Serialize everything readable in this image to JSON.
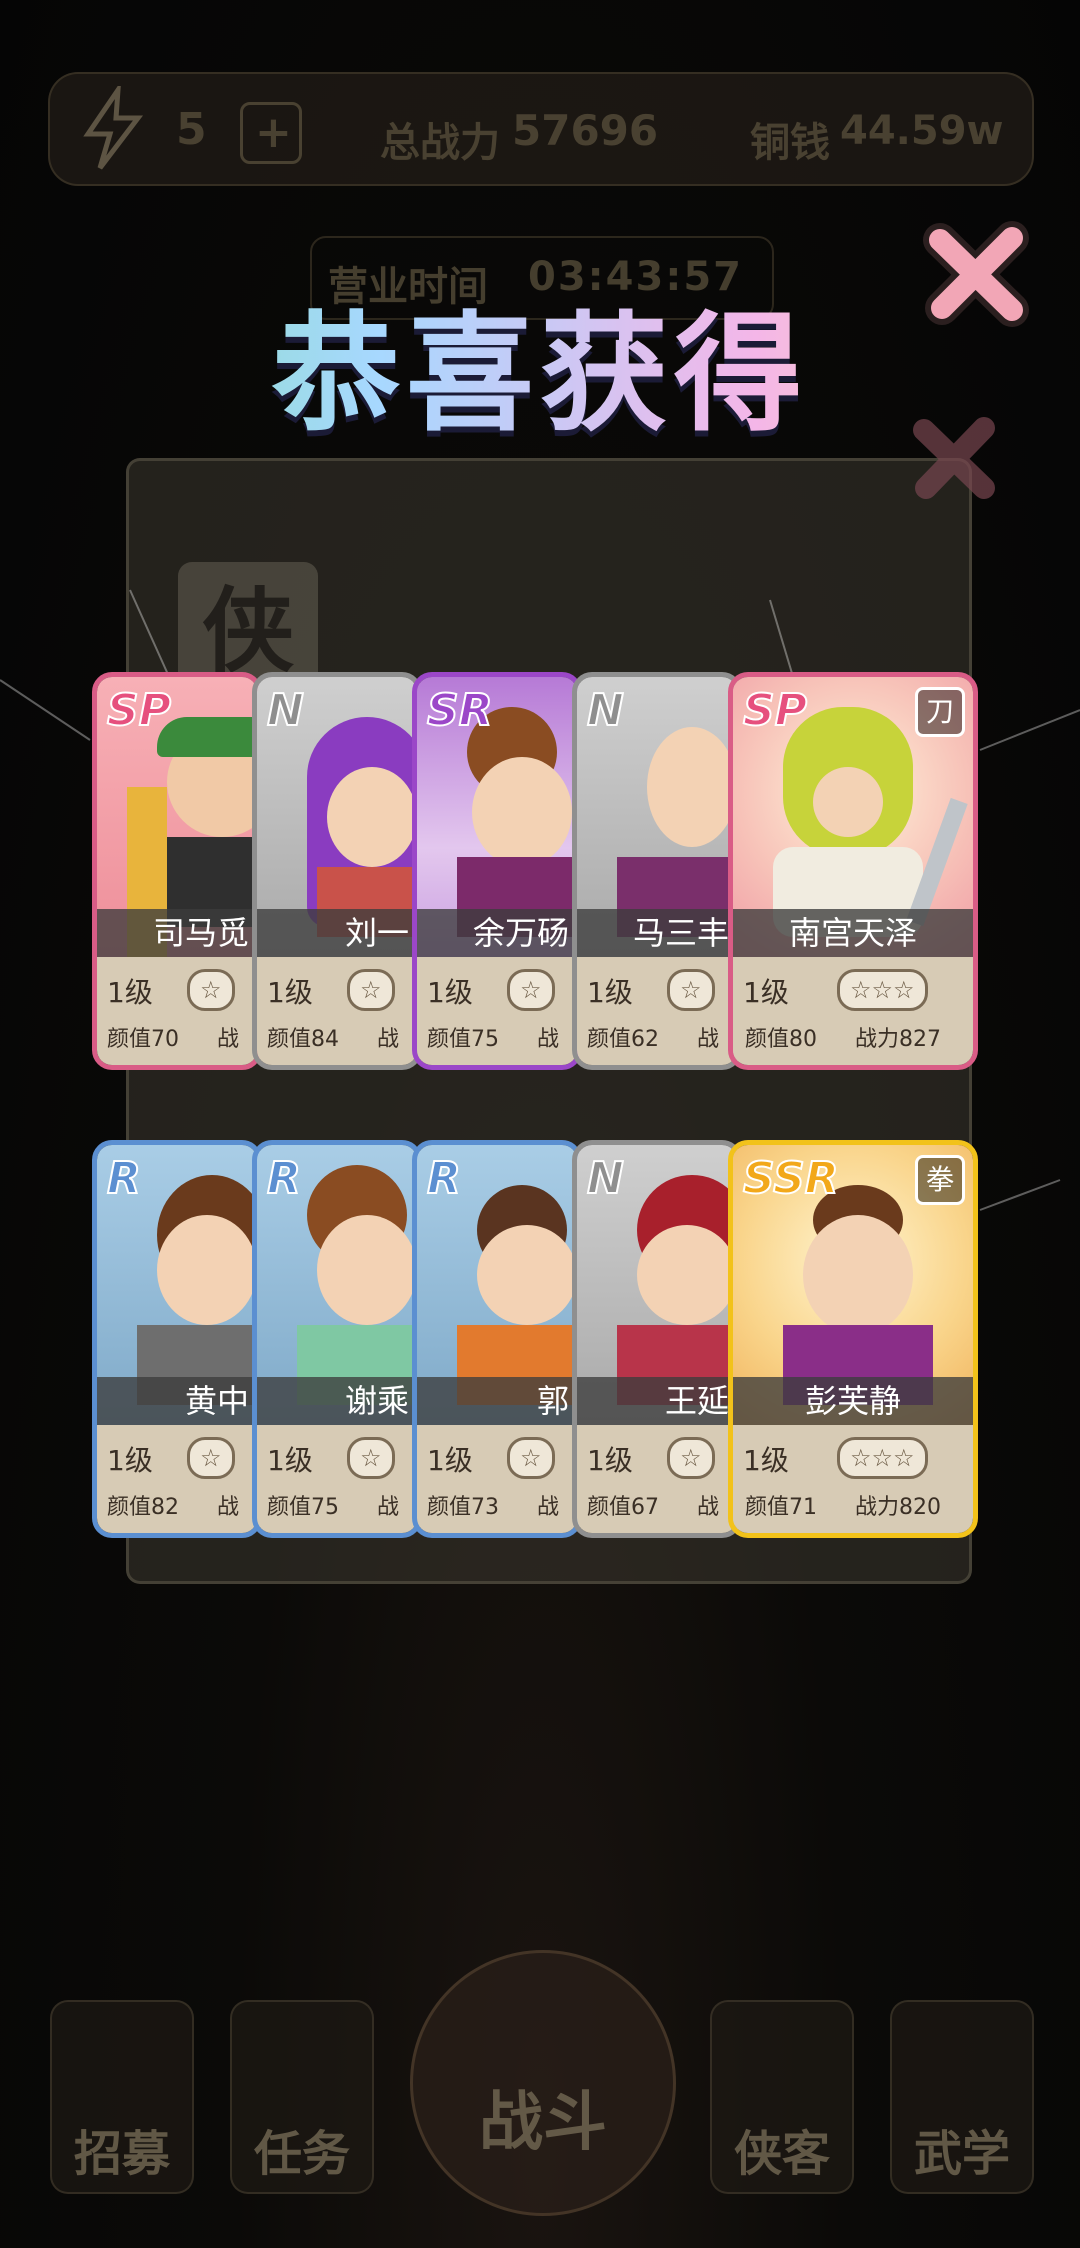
{
  "header": {
    "energy": "5",
    "power_label": "总战力",
    "power_value": "57696",
    "coin_label": "铜钱",
    "coin_value": "44.59w",
    "business_label": "营业时间",
    "business_time": "03:43:57"
  },
  "dim_panel": {
    "tag": "侠"
  },
  "popup": {
    "title": "恭喜获得"
  },
  "cards": [
    {
      "rarity": "SP",
      "name": "司马觅",
      "level": "1级",
      "stars": "☆",
      "charm": "颜值70",
      "power": "战"
    },
    {
      "rarity": "N",
      "name": "刘一",
      "level": "1级",
      "stars": "☆",
      "charm": "颜值84",
      "power": "战"
    },
    {
      "rarity": "SR",
      "name": "余万砀",
      "level": "1级",
      "stars": "☆",
      "charm": "颜值75",
      "power": "战"
    },
    {
      "rarity": "N",
      "name": "马三丰",
      "level": "1级",
      "stars": "☆",
      "charm": "颜值62",
      "power": "战"
    },
    {
      "rarity": "SP",
      "name": "南宫天泽",
      "tag": "刀",
      "level": "1级",
      "stars": "☆☆☆",
      "charm": "颜值80",
      "power": "战力827"
    },
    {
      "rarity": "R",
      "name": "黄中",
      "level": "1级",
      "stars": "☆",
      "charm": "颜值82",
      "power": "战"
    },
    {
      "rarity": "R",
      "name": "谢乘",
      "level": "1级",
      "stars": "☆",
      "charm": "颜值75",
      "power": "战"
    },
    {
      "rarity": "R",
      "name": "郭",
      "level": "1级",
      "stars": "☆",
      "charm": "颜值73",
      "power": "战"
    },
    {
      "rarity": "N",
      "name": "王延 ",
      "level": "1级",
      "stars": "☆",
      "charm": "颜值67",
      "power": "战"
    },
    {
      "rarity": "SSR",
      "name": "彭芙静",
      "tag": "拳",
      "level": "1级",
      "stars": "☆☆☆",
      "charm": "颜值71",
      "power": "战力820"
    }
  ],
  "bottom_nav": [
    {
      "label": "招募"
    },
    {
      "label": "任务"
    },
    {
      "label": "战斗"
    },
    {
      "label": "侠客"
    },
    {
      "label": "武学"
    }
  ],
  "colors": {
    "SP": "#e6507e",
    "N": "#8f8f8f",
    "SR": "#9b47c8",
    "R": "#5b8fd1",
    "SSR": "#f2c21a"
  }
}
